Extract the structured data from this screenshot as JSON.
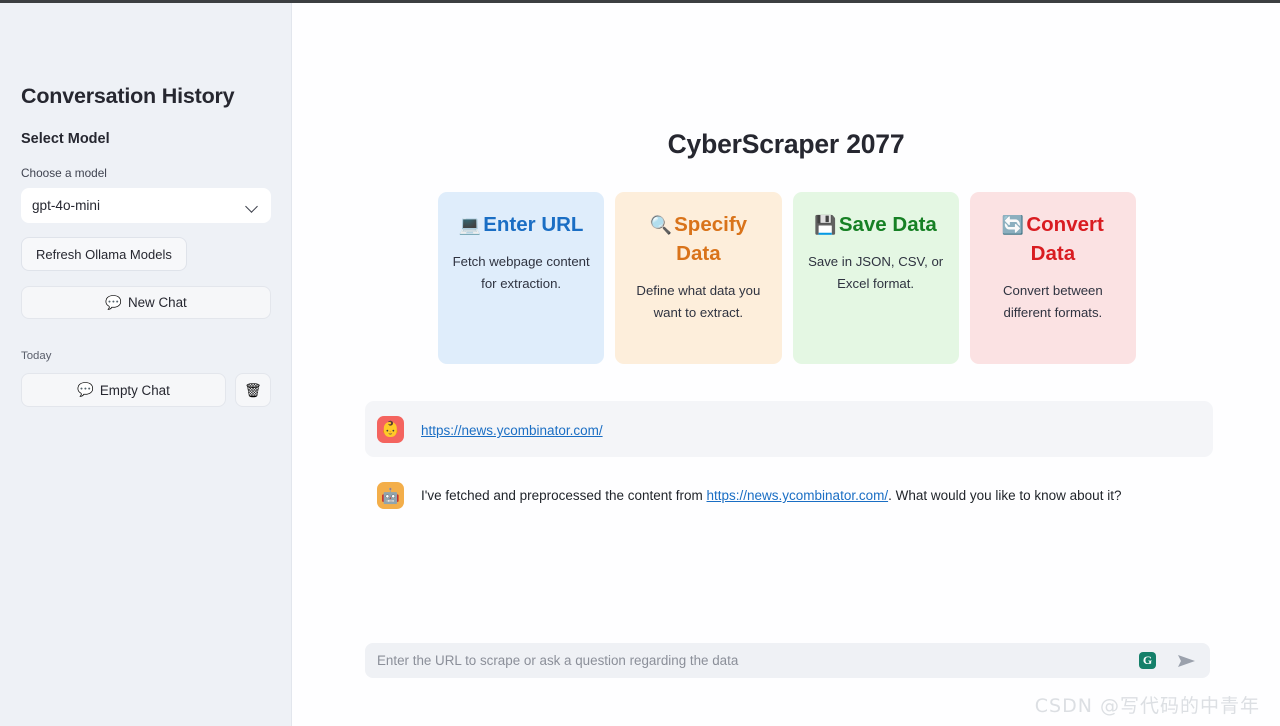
{
  "sidebar": {
    "title": "Conversation History",
    "select_model_heading": "Select Model",
    "choose_label": "Choose a model",
    "model_value": "gpt-4o-mini",
    "chevron_icon": "chevron-down-icon",
    "refresh_label": "Refresh Ollama Models",
    "new_chat": {
      "icon": "💬",
      "label": "New Chat"
    },
    "today_label": "Today",
    "chats": [
      {
        "icon": "💬",
        "label": "Empty Chat",
        "delete_icon": "🗑"
      }
    ]
  },
  "main": {
    "title": "CyberScraper 2077",
    "cards": [
      {
        "emoji": "💻",
        "title": "Enter URL",
        "desc": "Fetch webpage content for extraction.",
        "bg": "#dfedfb",
        "color": "#1a6ec4"
      },
      {
        "emoji": "🔍",
        "title": "Specify Data",
        "desc": "Define what data you want to extract.",
        "bg": "#fdeedb",
        "color": "#d9731a"
      },
      {
        "emoji": "💾",
        "title": "Save Data",
        "desc": "Save in JSON, CSV, or Excel format.",
        "bg": "#e4f7e3",
        "color": "#168024"
      },
      {
        "emoji": "🔄",
        "title": "Convert Data",
        "desc": "Convert between different formats.",
        "bg": "#fbe2e3",
        "color": "#d91c21"
      }
    ],
    "messages": [
      {
        "role": "user",
        "avatar_icon": "👶",
        "link": "https://news.ycombinator.com/"
      },
      {
        "role": "assistant",
        "avatar_icon": "🤖",
        "text_before": "I've fetched and preprocessed the content from ",
        "link": "https://news.ycombinator.com/",
        "text_after": ". What would you like to know about it?"
      }
    ]
  },
  "input": {
    "placeholder": "Enter the URL to scrape or ask a question regarding the data",
    "grammarly_icon": "G",
    "send_icon": "send-icon"
  },
  "watermark": "CSDN @写代码的中青年"
}
